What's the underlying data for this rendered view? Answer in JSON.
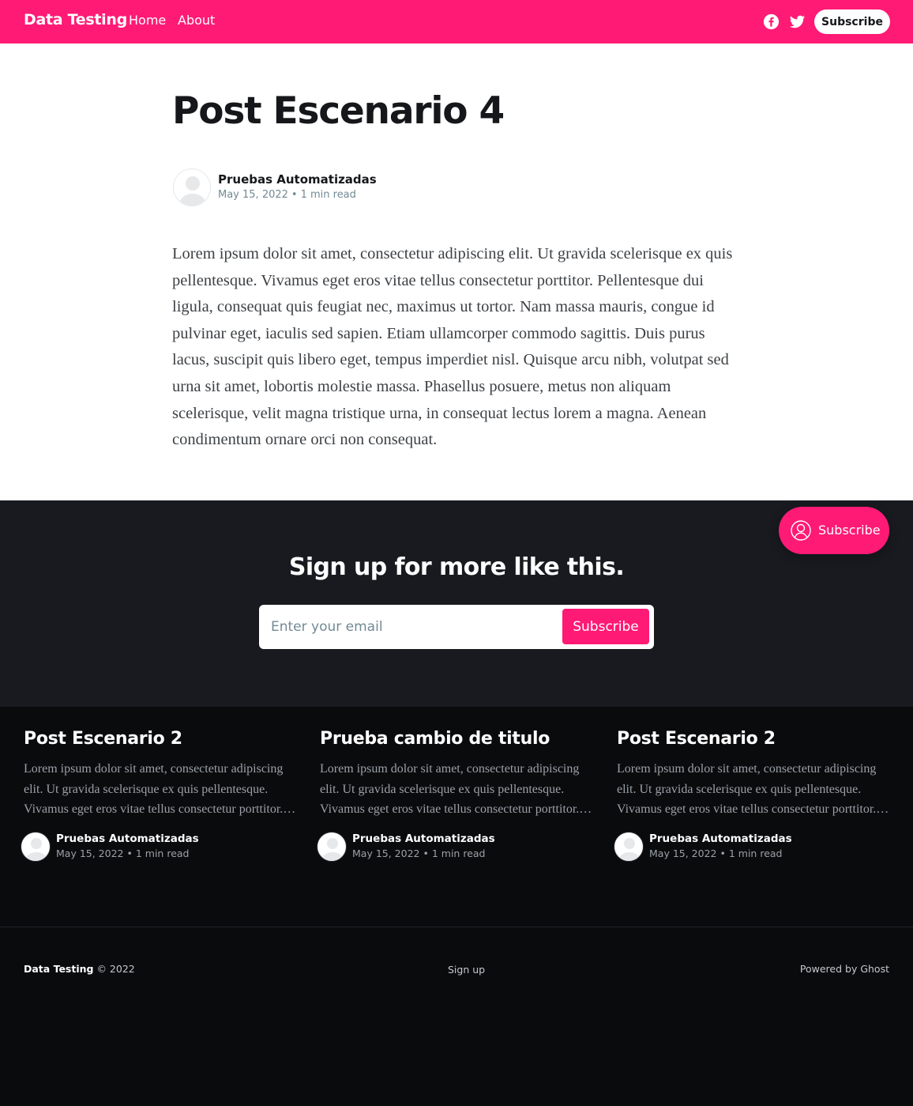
{
  "header": {
    "logo": "Data Testing",
    "nav": [
      {
        "label": "Home"
      },
      {
        "label": "About"
      }
    ],
    "social": [
      "facebook-icon",
      "twitter-icon"
    ],
    "subscribe_label": "Subscribe"
  },
  "article": {
    "title": "Post Escenario 4",
    "author": "Pruebas Automatizadas",
    "date": "May 15, 2022",
    "read_time": "1 min read",
    "body": "Lorem ipsum dolor sit amet, consectetur adipiscing elit. Ut gravida scelerisque ex quis pellentesque. Vivamus eget eros vitae tellus consectetur porttitor. Pellentesque dui ligula, consequat quis feugiat nec, maximus ut tortor. Nam massa mauris, congue id pulvinar eget, iaculis sed sapien. Etiam ullamcorper commodo sagittis. Duis purus lacus, suscipit quis libero eget, tempus imperdiet nisl. Quisque arcu nibh, volutpat sed urna sit amet, lobortis molestie massa. Phasellus posuere, metus non aliquam scelerisque, velit magna tristique urna, in consequat lectus lorem a magna. Aenean condimentum ornare orci non consequat."
  },
  "signup": {
    "title": "Sign up for more like this.",
    "email_placeholder": "Enter your email",
    "button_label": "Subscribe"
  },
  "floating_subscribe": {
    "label": "Subscribe"
  },
  "related": [
    {
      "title": "Post Escenario 2",
      "excerpt": "Lorem ipsum dolor sit amet, consectetur adipiscing elit. Ut gravida scelerisque ex quis pellentesque. Vivamus eget eros vitae tellus consectetur porttitor.…",
      "author": "Pruebas Automatizadas",
      "date": "May 15, 2022",
      "read_time": "1 min read"
    },
    {
      "title": "Prueba cambio de titulo",
      "excerpt": "Lorem ipsum dolor sit amet, consectetur adipiscing elit. Ut gravida scelerisque ex quis pellentesque. Vivamus eget eros vitae tellus consectetur porttitor.…",
      "author": "Pruebas Automatizadas",
      "date": "May 15, 2022",
      "read_time": "1 min read"
    },
    {
      "title": "Post Escenario 2",
      "excerpt": "Lorem ipsum dolor sit amet, consectetur adipiscing elit. Ut gravida scelerisque ex quis pellentesque. Vivamus eget eros vitae tellus consectetur porttitor.…",
      "author": "Pruebas Automatizadas",
      "date": "May 15, 2022",
      "read_time": "1 min read"
    }
  ],
  "footer": {
    "site_name": "Data Testing",
    "copyright": "© 2022",
    "signup_link": "Sign up",
    "powered_by": "Powered by Ghost"
  },
  "colors": {
    "accent": "#ff1a75",
    "signup_bg": "#181a1f",
    "footer_bg": "#0a0b0d"
  }
}
